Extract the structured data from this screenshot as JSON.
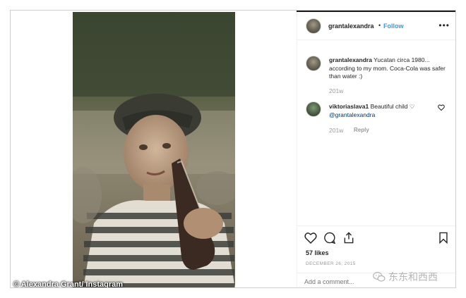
{
  "photo": {
    "credit": "© Alexandra Grant/ Instagram"
  },
  "post": {
    "username": "grantalexandra",
    "separator": "•",
    "follow_label": "Follow",
    "more_label": "•••"
  },
  "caption": {
    "username": "grantalexandra",
    "text": "Yucatan circa 1980... according to my mom. Coca-Cola was safer than water :)",
    "time": "201w"
  },
  "comments": [
    {
      "username": "viktoriaslava1",
      "text": "Beautiful child ♡",
      "mention": "@grantalexandra",
      "time": "201w",
      "reply_label": "Reply"
    }
  ],
  "actions": {
    "likes": "57 likes",
    "date": "DECEMBER 26, 2015",
    "add_comment_placeholder": "Add a comment..."
  },
  "watermark": {
    "text": "东东和西西"
  },
  "colors": {
    "link_blue": "#3897f0",
    "mention_blue": "#003569",
    "muted_gray": "#999999",
    "border": "#efefef"
  },
  "icons": [
    "more-options-icon",
    "heart-icon",
    "comment-icon",
    "share-icon",
    "bookmark-icon",
    "wechat-icon"
  ]
}
